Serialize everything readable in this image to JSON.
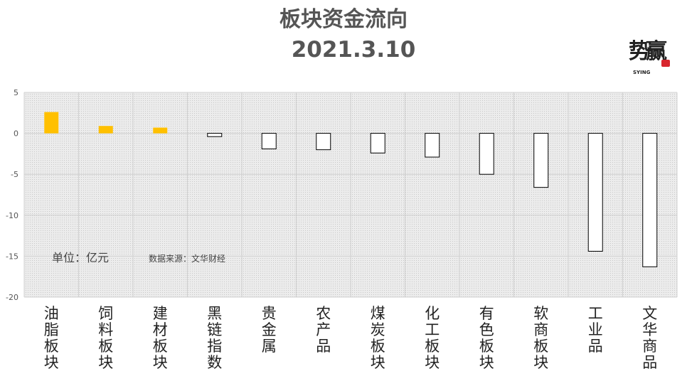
{
  "header": {
    "title_line1": "板块资金流向",
    "title_line2": "2021.3.10"
  },
  "logo": {
    "text": "势赢",
    "sub": "SYING"
  },
  "notes": {
    "unit": "单位：亿元",
    "source": "数据来源：文华财经"
  },
  "chart_data": {
    "type": "bar",
    "categories": [
      "油脂板块",
      "饲料板块",
      "建材板块",
      "黑链指数",
      "贵金属",
      "农产品",
      "煤炭板块",
      "化工板块",
      "有色板块",
      "软商板块",
      "工业品",
      "文华商品"
    ],
    "values": [
      2.6,
      0.9,
      0.7,
      -0.4,
      -1.9,
      -2.0,
      -2.4,
      -2.9,
      -5.0,
      -6.6,
      -14.4,
      -16.3
    ],
    "ylim": [
      -20,
      5
    ],
    "yticks": [
      5,
      0,
      -5,
      -10,
      -15,
      -20
    ],
    "grid": true,
    "colors": {
      "positive": "#ffc000",
      "negative": "#ffffff",
      "negative_border": "#000000"
    }
  }
}
